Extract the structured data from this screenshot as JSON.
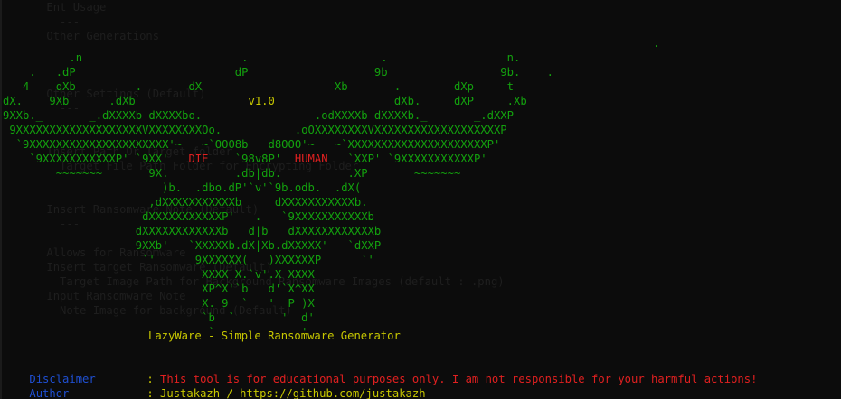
{
  "colors": {
    "background": "#0c0c0c",
    "art_green": "#13a10e",
    "accent_yellow": "#c8c800",
    "alert_red": "#e02020",
    "label_blue": "#1f4fd1"
  },
  "banner": {
    "version": "v1.0",
    "die_word": "DIE",
    "human_word": "HUMAN"
  },
  "tagline": "LazyWare - Simple Ransomware Generator",
  "info": {
    "disclaimer_label": "Disclaimer",
    "disclaimer_text": "This tool is for educational purposes only. I am not responsible for your harmful actions!",
    "author_label": "Author",
    "author_text": "Justakazh / https://github.com/justakazh",
    "separator": ":"
  }
}
